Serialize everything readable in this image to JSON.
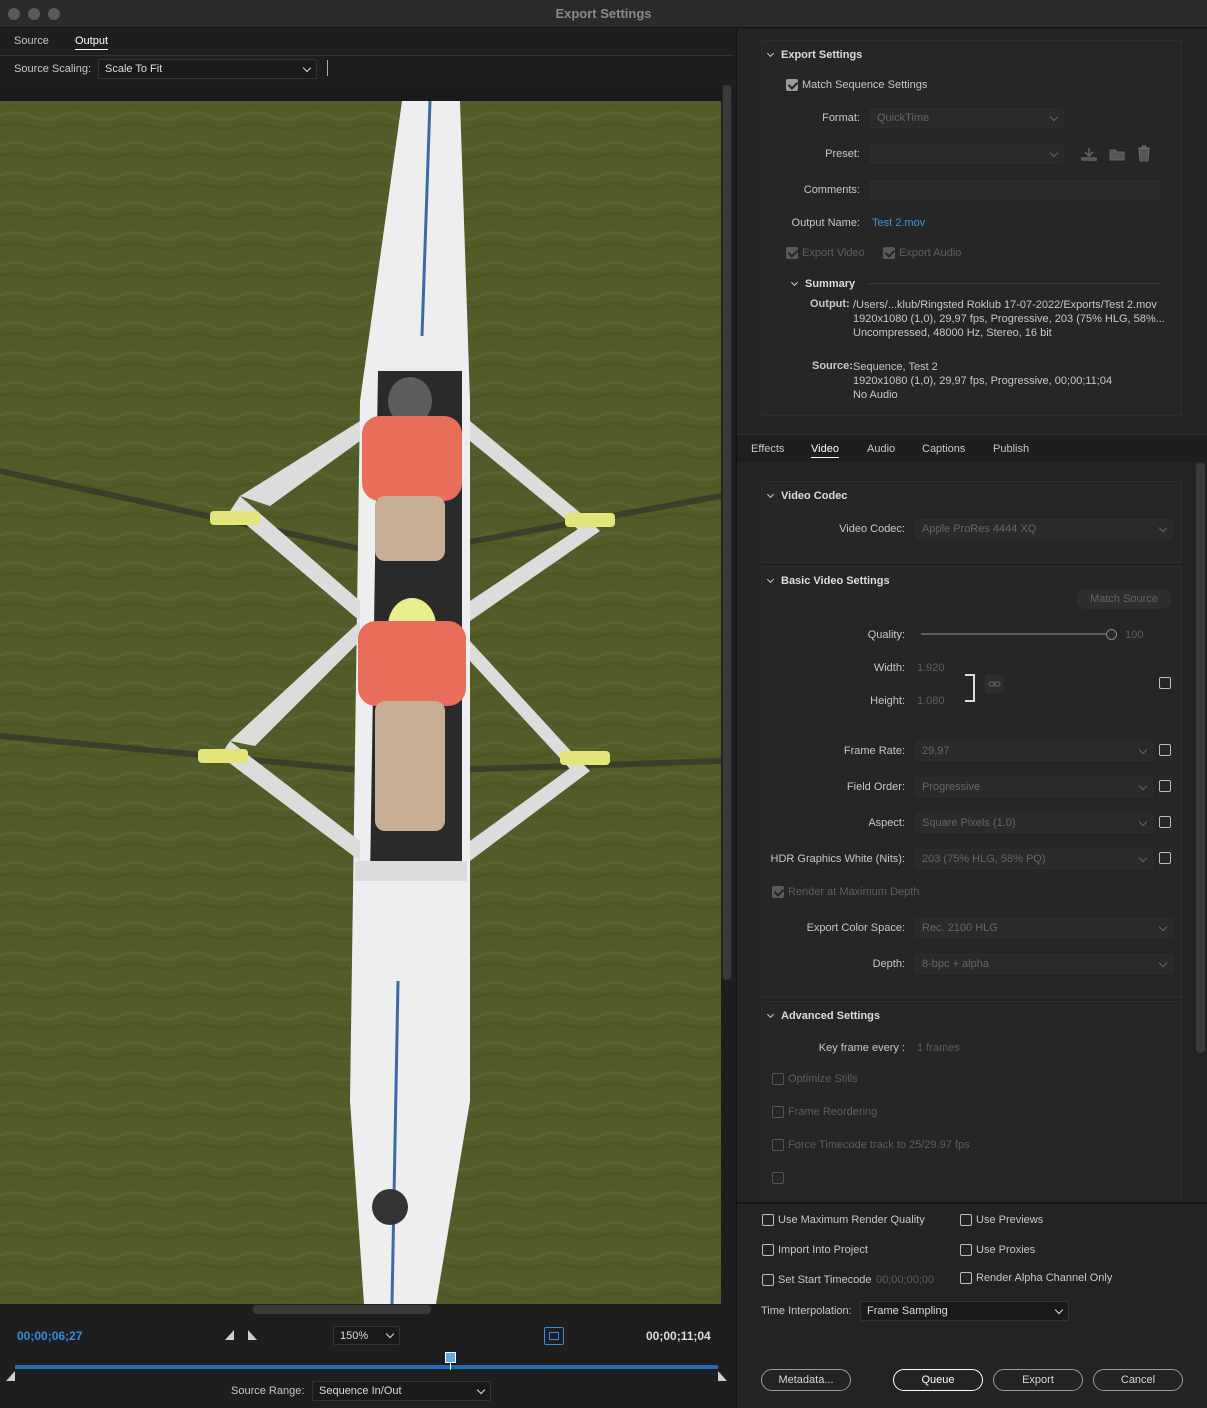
{
  "window": {
    "title": "Export Settings"
  },
  "left_tabs": [
    "Source",
    "Output"
  ],
  "source_scaling": {
    "label": "Source Scaling:",
    "value": "Scale To Fit"
  },
  "timeline": {
    "current": "00;00;06;27",
    "duration": "00;00;11;04",
    "zoom": "150%",
    "playhead_fraction": 0.61,
    "source_range_label": "Source Range:",
    "source_range": "Sequence In/Out"
  },
  "export_settings": {
    "heading": "Export Settings",
    "match_sequence": "Match Sequence Settings",
    "format_label": "Format:",
    "format": "QuickTime",
    "preset_label": "Preset:",
    "preset": "",
    "comments_label": "Comments:",
    "output_name_label": "Output Name:",
    "output_name": "Test 2.mov",
    "export_video": "Export Video",
    "export_audio": "Export Audio"
  },
  "summary": {
    "heading": "Summary",
    "output_label": "Output:",
    "output_lines": [
      "/Users/...klub/Ringsted Roklub 17-07-2022/Exports/Test 2.mov",
      "1920x1080 (1,0), 29,97 fps, Progressive, 203 (75% HLG, 58%...",
      "Uncompressed, 48000 Hz, Stereo, 16 bit"
    ],
    "source_label": "Source:",
    "source_lines": [
      "Sequence, Test 2",
      "1920x1080 (1,0), 29,97 fps, Progressive, 00;00;11;04",
      "No Audio"
    ]
  },
  "right_tabs": [
    "Effects",
    "Video",
    "Audio",
    "Captions",
    "Publish"
  ],
  "video_codec": {
    "heading": "Video Codec",
    "label": "Video Codec:",
    "value": "Apple ProRes 4444 XQ"
  },
  "basic_video": {
    "heading": "Basic Video Settings",
    "match_source": "Match Source",
    "quality_label": "Quality:",
    "quality": "100",
    "width_label": "Width:",
    "width": "1.920",
    "height_label": "Height:",
    "height": "1.080",
    "frame_rate_label": "Frame Rate:",
    "frame_rate": "29,97",
    "field_order_label": "Field Order:",
    "field_order": "Progressive",
    "aspect_label": "Aspect:",
    "aspect": "Square Pixels (1.0)",
    "hdr_label": "HDR Graphics White (Nits):",
    "hdr": "203 (75% HLG, 58% PQ)",
    "render_max_depth": "Render at Maximum Depth",
    "color_space_label": "Export Color Space:",
    "color_space": "Rec. 2100 HLG",
    "depth_label": "Depth:",
    "depth": "8-bpc + alpha"
  },
  "advanced": {
    "heading": "Advanced Settings",
    "keyframe_label": "Key frame every :",
    "keyframe": "1  frames",
    "optimize_stills": "Optimize Stills",
    "frame_reordering": "Frame Reordering",
    "force_timecode": "Force Timecode track to 25/29.97 fps"
  },
  "bottom": {
    "use_max_render": "Use Maximum Render Quality",
    "use_previews": "Use Previews",
    "import_into_project": "Import Into Project",
    "use_proxies": "Use Proxies",
    "set_start_timecode": "Set Start Timecode",
    "start_timecode": "00;00;00;00",
    "render_alpha": "Render Alpha Channel Only",
    "time_interp_label": "Time Interpolation:",
    "time_interp": "Frame Sampling"
  },
  "buttons": {
    "metadata": "Metadata...",
    "queue": "Queue",
    "export": "Export",
    "cancel": "Cancel"
  }
}
